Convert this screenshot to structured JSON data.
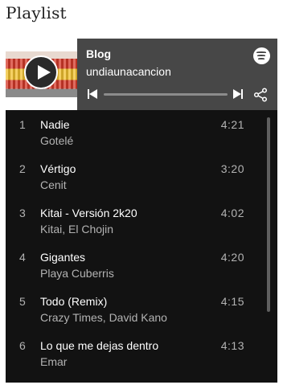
{
  "page": {
    "heading": "Playlist"
  },
  "player": {
    "title": "Blog",
    "subtitle": "undiaunacancion",
    "progress": 0
  },
  "tracks": [
    {
      "num": "1",
      "name": "Nadie",
      "artist": "Gotelé",
      "duration": "4:21"
    },
    {
      "num": "2",
      "name": "Vértigo",
      "artist": "Cenit",
      "duration": "3:20"
    },
    {
      "num": "3",
      "name": "Kitai - Versión 2k20",
      "artist": "Kitai, El Chojin",
      "duration": "4:02"
    },
    {
      "num": "4",
      "name": "Gigantes",
      "artist": "Playa Cuberris",
      "duration": "4:20"
    },
    {
      "num": "5",
      "name": "Todo (Remix)",
      "artist": "Crazy Times, David Kano",
      "duration": "4:15"
    },
    {
      "num": "6",
      "name": "Lo que me dejas dentro",
      "artist": "Emar",
      "duration": "4:13"
    }
  ],
  "icons": {
    "play": "play-icon",
    "spotify": "spotify-logo-icon",
    "previous": "skip-previous-icon",
    "next": "skip-next-icon",
    "share": "share-icon"
  }
}
